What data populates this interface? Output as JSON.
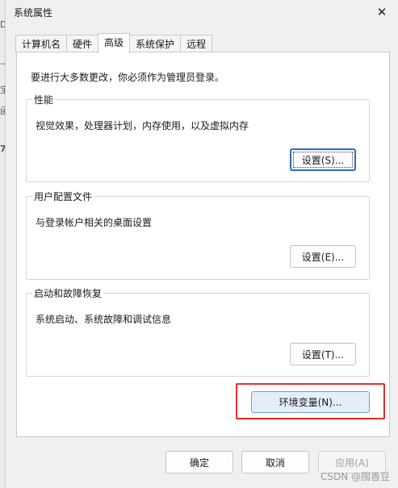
{
  "backdrop": {
    "glyphs": [
      "DI",
      "—",
      "宝",
      "函",
      "7"
    ]
  },
  "window": {
    "title": "系统属性",
    "close_glyph": "✕"
  },
  "tabs": [
    {
      "label": "计算机名",
      "active": false
    },
    {
      "label": "硬件",
      "active": false
    },
    {
      "label": "高级",
      "active": true
    },
    {
      "label": "系统保护",
      "active": false
    },
    {
      "label": "远程",
      "active": false
    }
  ],
  "panel": {
    "admin_note": "要进行大多数更改，你必须作为管理员登录。",
    "performance": {
      "title": "性能",
      "description": "视觉效果，处理器计划，内存使用，以及虚拟内存",
      "button": "设置(S)..."
    },
    "user_profiles": {
      "title": "用户配置文件",
      "description": "与登录帐户相关的桌面设置",
      "button": "设置(E)..."
    },
    "startup_recovery": {
      "title": "启动和故障恢复",
      "description": "系统启动、系统故障和调试信息",
      "button": "设置(T)..."
    },
    "env_button": "环境变量(N)..."
  },
  "footer": {
    "ok": "确定",
    "cancel": "取消",
    "apply": "应用(A)"
  },
  "watermark": "CSDN @囤香豆",
  "colors": {
    "highlight": "#e52e2e",
    "focus": "#2c6bc4"
  }
}
